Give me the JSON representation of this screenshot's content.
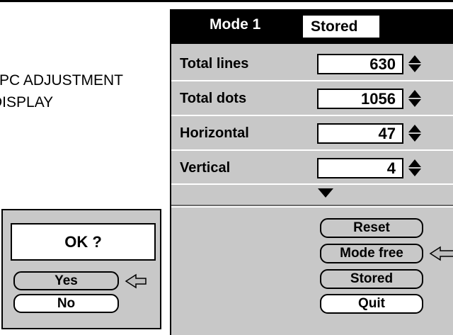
{
  "caption": {
    "line1": "PC ADJUSTMENT",
    "line2": "DISPLAY"
  },
  "confirm": {
    "prompt": "OK ?",
    "yes_label": "Yes",
    "no_label": "No"
  },
  "panel": {
    "title": "Mode 1",
    "mode_status": "Stored",
    "rows": [
      {
        "label": "Total lines",
        "value": "630"
      },
      {
        "label": "Total dots",
        "value": "1056"
      },
      {
        "label": "Horizontal",
        "value": "47"
      },
      {
        "label": "Vertical",
        "value": "4"
      }
    ],
    "buttons": {
      "reset": "Reset",
      "mode_free": "Mode free",
      "stored": "Stored",
      "quit": "Quit"
    }
  },
  "icons": {
    "pointer": "left-arrow-pointer-icon",
    "spinner": "up-down-spinner-icon",
    "expand": "triangle-down-icon"
  },
  "colors": {
    "panel_bg": "#c8c8c8",
    "title_bg": "#000000"
  }
}
